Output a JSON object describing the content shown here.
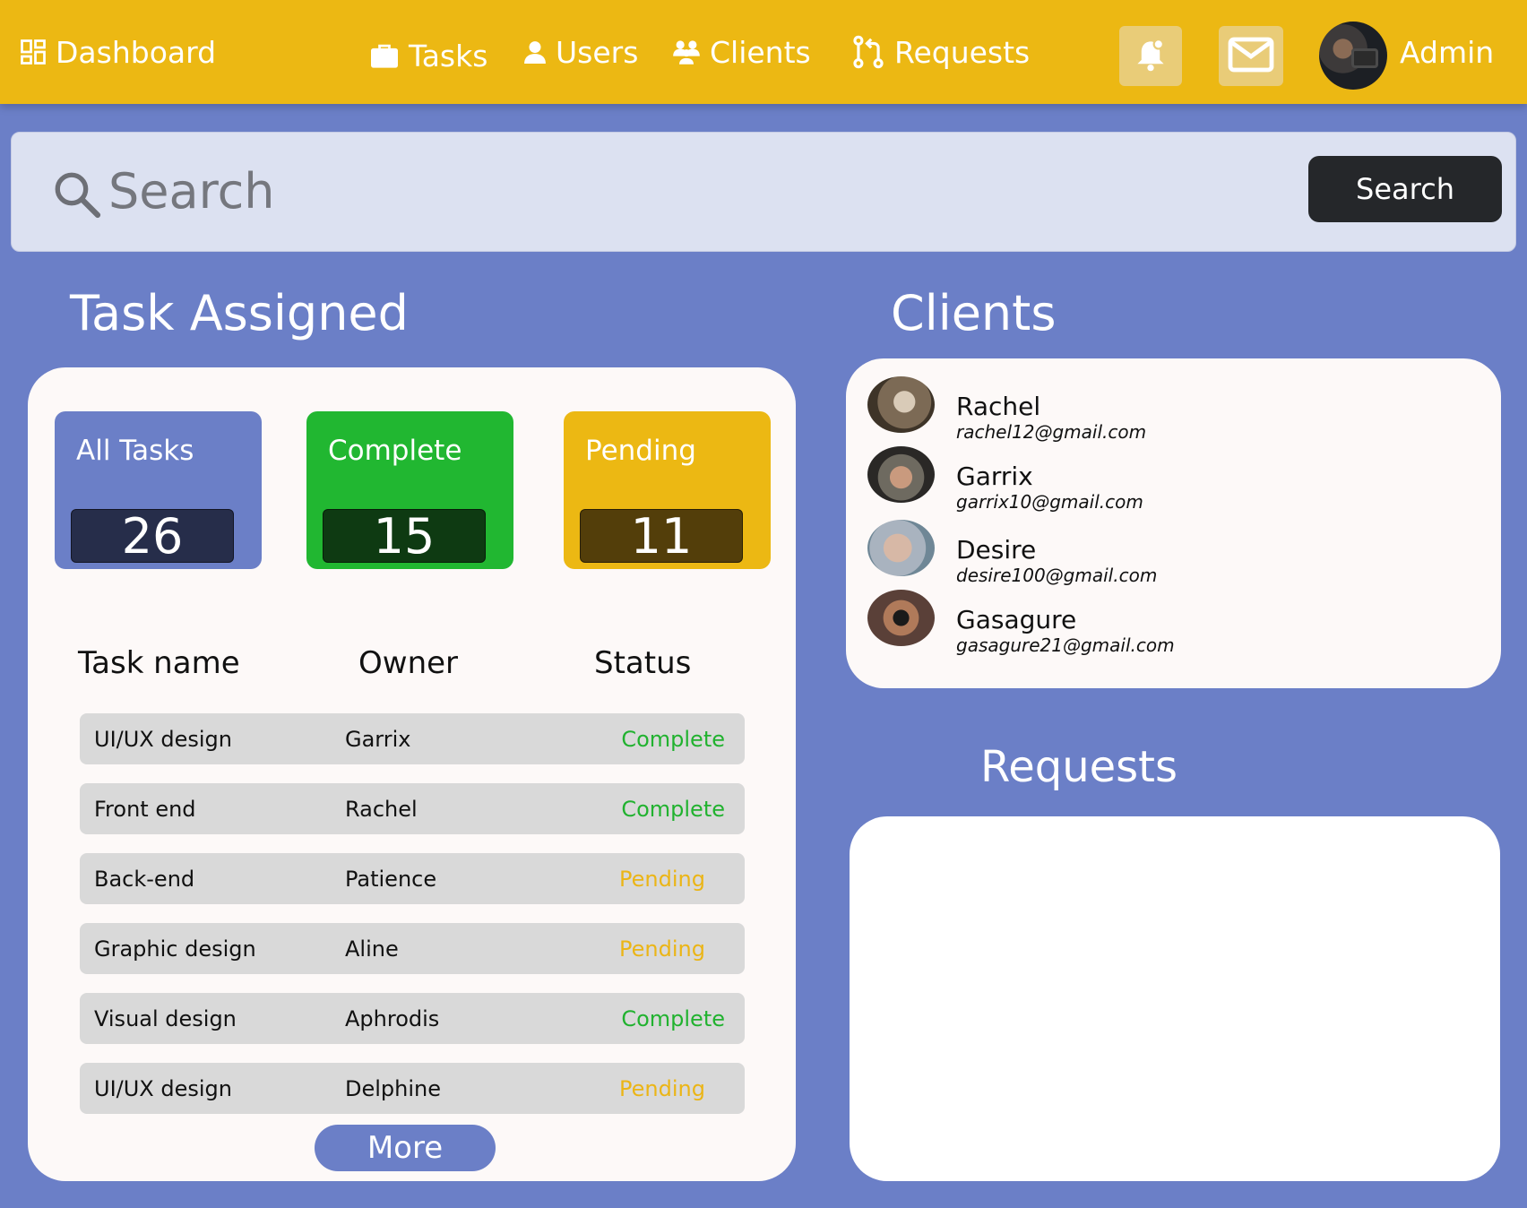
{
  "nav": {
    "dashboard": "Dashboard",
    "tasks": "Tasks",
    "users": "Users",
    "clients": "Clients",
    "requests": "Requests",
    "admin": "Admin",
    "icons": [
      "dashboard-icon",
      "briefcase-icon",
      "user-icon",
      "group-icon",
      "pull-request-icon",
      "bell-icon",
      "mail-icon"
    ]
  },
  "search": {
    "placeholder": "Search",
    "button_label": "Search"
  },
  "tasks_section": {
    "title": "Task Assigned",
    "stats": [
      {
        "label": "All Tasks",
        "value": "26",
        "color": "#6b7fc7",
        "value_bg": "#262d4a"
      },
      {
        "label": "Complete",
        "value": "15",
        "color": "#21b731",
        "value_bg": "#0e3a12"
      },
      {
        "label": "Pending",
        "value": "11",
        "color": "#ecb813",
        "value_bg": "#533e0a"
      }
    ],
    "columns": [
      "Task name",
      "Owner",
      "Status"
    ],
    "rows": [
      {
        "name": "UI/UX design",
        "owner": "Garrix",
        "status": "Complete"
      },
      {
        "name": "Front end",
        "owner": "Rachel",
        "status": "Complete"
      },
      {
        "name": "Back-end",
        "owner": "Patience",
        "status": "Pending"
      },
      {
        "name": "Graphic design",
        "owner": "Aline",
        "status": "Pending"
      },
      {
        "name": "Visual design",
        "owner": "Aphrodis",
        "status": "Complete"
      },
      {
        "name": "UI/UX design",
        "owner": "Delphine",
        "status": "Pending"
      }
    ],
    "more_label": "More"
  },
  "clients_section": {
    "title": "Clients",
    "clients": [
      {
        "name": "Rachel",
        "email": "rachel12@gmail.com"
      },
      {
        "name": "Garrix",
        "email": "garrix10@gmail.com"
      },
      {
        "name": "Desire",
        "email": "desire100@gmail.com"
      },
      {
        "name": "Gasagure",
        "email": "gasagure21@gmail.com"
      }
    ]
  },
  "requests_section": {
    "title": "Requests"
  },
  "colors": {
    "background": "#6b7fc7",
    "topbar": "#ecb813",
    "complete": "#21b22f",
    "pending": "#ebb516"
  }
}
